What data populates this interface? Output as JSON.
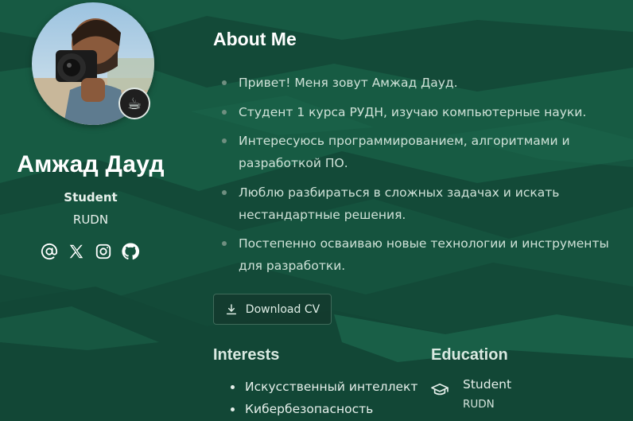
{
  "profile": {
    "name": "Амжад Дауд",
    "role": "Student",
    "organization": "RUDN",
    "status_emoji": "☕",
    "socials": [
      {
        "icon": "at-sign-icon"
      },
      {
        "icon": "x-twitter-icon"
      },
      {
        "icon": "instagram-icon"
      },
      {
        "icon": "github-icon"
      }
    ]
  },
  "about": {
    "title": "About Me",
    "items": [
      "Привет! Меня зовут Амжад Дауд.",
      "Студент 1 курса РУДН, изучаю компьютерные науки.",
      "Интересуюсь программированием, алгоритмами и разработкой ПО.",
      "Люблю разбираться в сложных задачах и искать нестандартные решения.",
      "Постепенно осваиваю новые технологии и инструменты для разработки."
    ],
    "download_label": "Download CV"
  },
  "interests": {
    "title": "Interests",
    "items": [
      "Искусственный интеллект",
      "Кибербезопасность"
    ]
  },
  "education": {
    "title": "Education",
    "items": [
      {
        "degree": "Student",
        "school": "RUDN"
      }
    ]
  },
  "colors": {
    "background": "#134a38",
    "text": "#e6f2ec",
    "muted": "#cfe2d8",
    "bullet": "#6f8f80"
  }
}
